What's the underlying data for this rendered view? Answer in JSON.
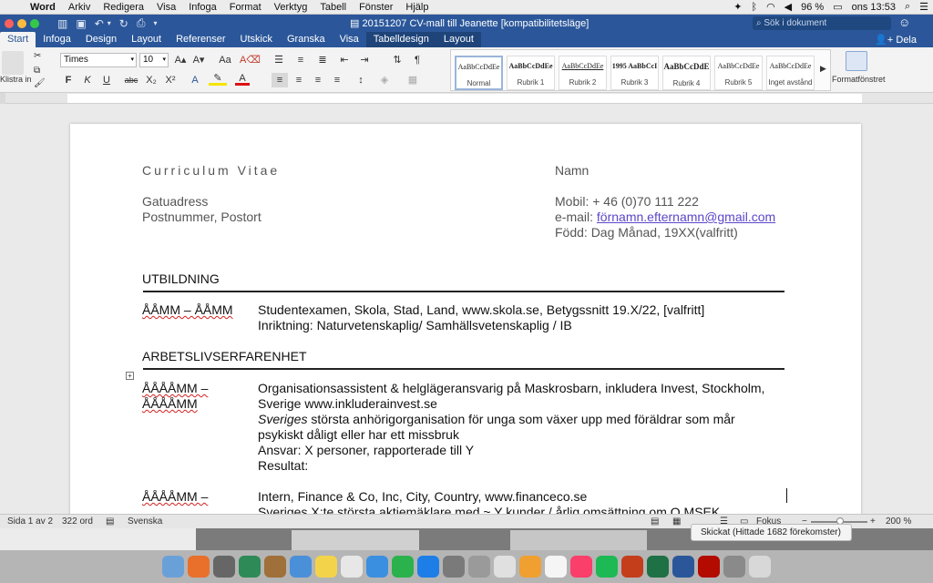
{
  "menubar": {
    "app": "Word",
    "items": [
      "Arkiv",
      "Redigera",
      "Visa",
      "Infoga",
      "Format",
      "Verktyg",
      "Tabell",
      "Fönster",
      "Hjälp"
    ],
    "battery": "96 %",
    "clock": "ons 13:53"
  },
  "titlebar": {
    "doc_title": "20151207 CV-mall till Jeanette [kompatibilitetsläge]",
    "search_placeholder": "Sök i dokument"
  },
  "tabs": [
    {
      "label": "Start",
      "active": true
    },
    {
      "label": "Infoga"
    },
    {
      "label": "Design"
    },
    {
      "label": "Layout"
    },
    {
      "label": "Referenser"
    },
    {
      "label": "Utskick"
    },
    {
      "label": "Granska"
    },
    {
      "label": "Visa"
    },
    {
      "label": "Tabelldesign",
      "tool": true
    },
    {
      "label": "Layout",
      "tool": true
    }
  ],
  "share_label": "Dela",
  "ribbon": {
    "paste_label": "Klistra in",
    "font": "Times",
    "size": "10",
    "styles_preview": [
      "AaBbCcDdEe",
      "AaBbCcDdEe",
      "AaBbCcDdEe",
      "1995 AaBbCcI",
      "AaBbCcDdE",
      "AaBbCcDdEe",
      "AaBbCcDdEe"
    ],
    "styles": [
      "Normal",
      "Rubrik 1",
      "Rubrik 2",
      "Rubrik 3",
      "Rubrik 4",
      "Rubrik 5",
      "Inget avstånd"
    ],
    "format_pane": "Formatfönstret"
  },
  "doc": {
    "cv_title": "Curriculum Vitae",
    "name": "Namn",
    "street": "Gatuadress",
    "postal": "Postnummer, Postort",
    "mobile": "Mobil: + 46 (0)70 111 222",
    "email_prefix": "e-mail: ",
    "email": "förnamn.efternamn@gmail.com",
    "born": "Född:  Dag Månad, 19XX(valfritt)",
    "edu_heading": "UTBILDNING",
    "edu_date": "ÅÅMM – ÅÅMM",
    "edu_line1": "Studentexamen, Skola, Stad, Land, www.skola.se, Betygssnitt 19.X/22, [valfritt]",
    "edu_line2": "Inriktning: Naturvetenskaplig/ Samhällsvetenskaplig / IB",
    "work_heading": "ARBETSLIVSERFARENHET",
    "job1_date1": "ÅÅÅÅMM –",
    "job1_date2": "ÅÅÅÅMM",
    "job1_line1": "Organisationsassistent & helglägeransvarig på Maskrosbarn, inkludera Invest, Stockholm,",
    "job1_line2": "Sverige  www.inkluderainvest.se",
    "job1_line3_italic": "Sveriges",
    "job1_line3": " största anhörigorganisation för unga som växer upp med föräldrar som mår",
    "job1_line4": "psykiskt dåligt eller har ett missbruk",
    "job1_line5": "Ansvar: X personer, rapporterade till Y",
    "job1_line6": "Resultat:",
    "job2_date": "ÅÅÅÅMM –",
    "job2_line1": "Intern, Finance & Co, Inc, City, Country, www.financeco.se",
    "job2_line2": "Sveriges X:te största aktiemäklare med ~ Y kunder / årlig omsättning om Q MSEK"
  },
  "status": {
    "page": "Sida 1 av 2",
    "words": "322 ord",
    "lang": "Svenska",
    "focus": "Fokus",
    "zoom": "200 %"
  },
  "notification": "Skickat (Hittade 1682 förekomster)",
  "colors": {
    "accent": "#2b579a",
    "link": "#5b47c9"
  }
}
